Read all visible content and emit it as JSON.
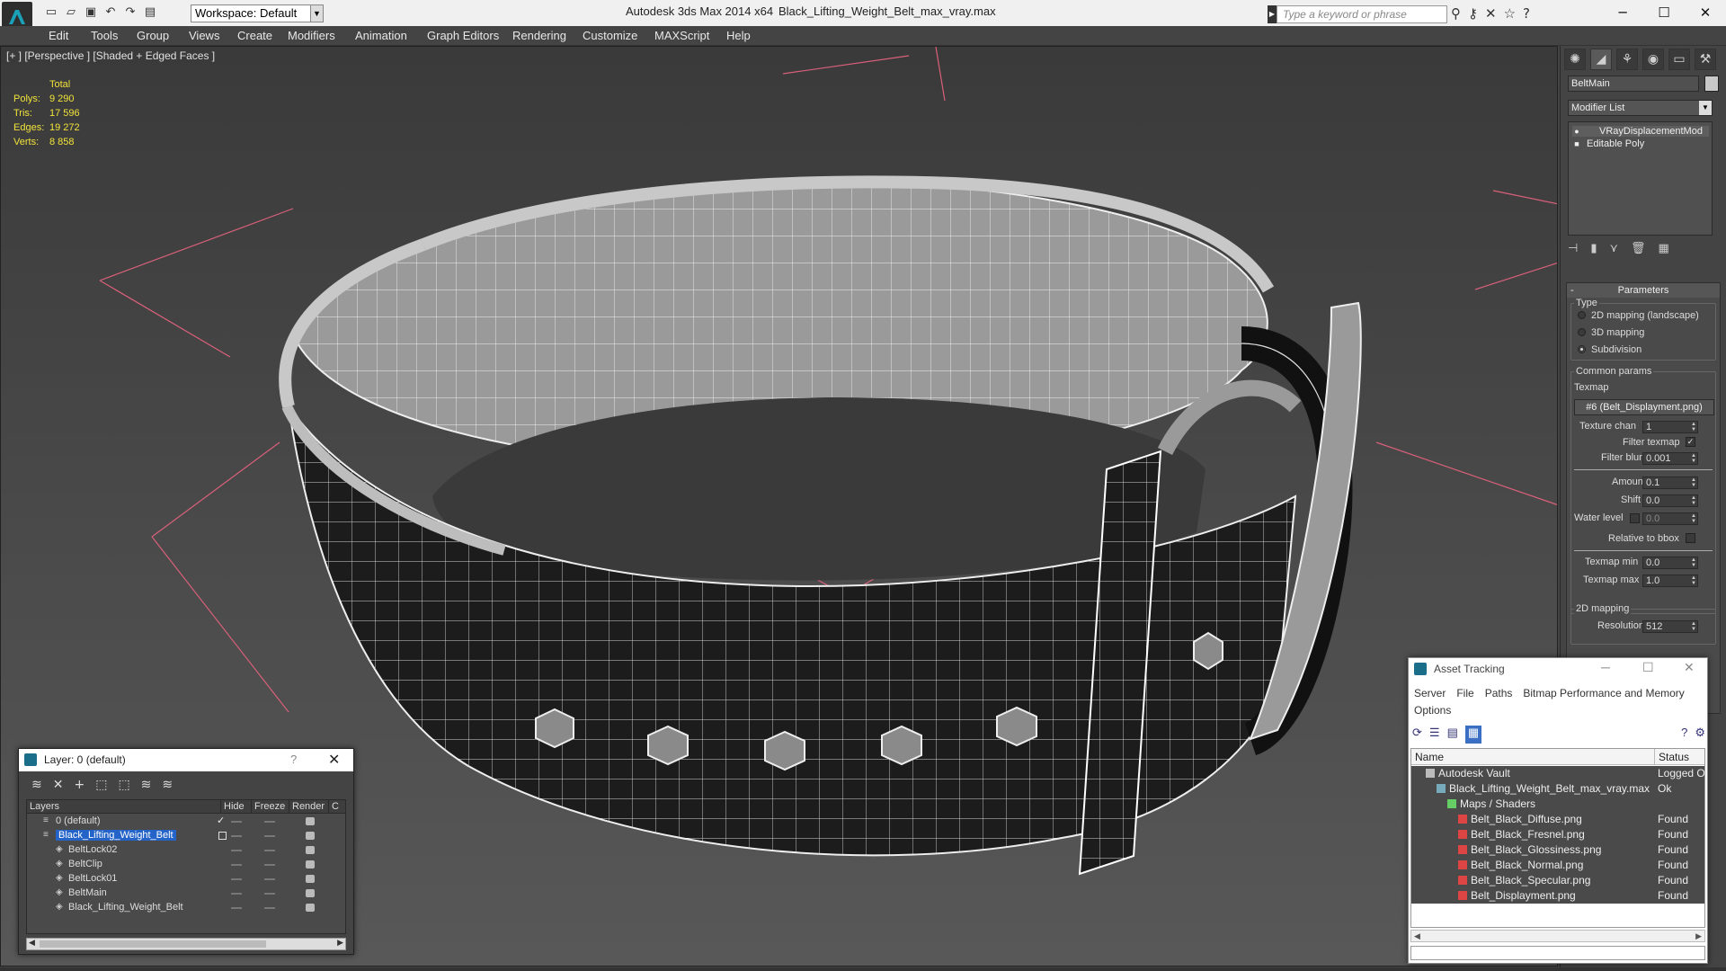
{
  "titlebar": {
    "workspace": "Workspace: Default",
    "app_title": "Autodesk 3ds Max  2014 x64",
    "file_title": "Black_Lifting_Weight_Belt_max_vray.max",
    "search_placeholder": "Type a keyword or phrase"
  },
  "menu": [
    "Edit",
    "Tools",
    "Group",
    "Views",
    "Create",
    "Modifiers",
    "Animation",
    "Graph Editors",
    "Rendering",
    "Customize",
    "MAXScript",
    "Help"
  ],
  "viewport": {
    "label": "[+ ] [Perspective ] [Shaded + Edged Faces ]",
    "stats": {
      "header": "Total",
      "rows": [
        {
          "k": "Polys:",
          "v": "9 290"
        },
        {
          "k": "Tris:",
          "v": "17 596"
        },
        {
          "k": "Edges:",
          "v": "19 272"
        },
        {
          "k": "Verts:",
          "v": "8 858"
        }
      ]
    }
  },
  "command_panel": {
    "object_name": "BeltMain",
    "modifier_list": "Modifier List",
    "stack": [
      "VRayDisplacementMod",
      "Editable Poly"
    ],
    "params": {
      "header": "Parameters",
      "type_label": "Type",
      "types": [
        "2D mapping (landscape)",
        "3D mapping",
        "Subdivision"
      ],
      "selected_type": "Subdivision",
      "common_label": "Common params",
      "texmap_label": "Texmap",
      "texmap_value": "#6 (Belt_Displayment.png)",
      "texture_chan_label": "Texture chan",
      "texture_chan": "1",
      "filter_texmap_label": "Filter texmap",
      "filter_blur_label": "Filter blur",
      "filter_blur": "0.001",
      "amount_label": "Amount",
      "amount": "0.1",
      "shift_label": "Shift",
      "shift": "0.0",
      "water_label": "Water level",
      "water": "0.0",
      "relative_label": "Relative to bbox",
      "texmap_min_label": "Texmap min",
      "texmap_min": "0.0",
      "texmap_max_label": "Texmap max",
      "texmap_max": "1.0",
      "mapping2d_label": "2D mapping",
      "resolution_label": "Resolution",
      "resolution": "512"
    }
  },
  "layer_window": {
    "title": "Layer: 0 (default)",
    "columns": [
      "Layers",
      "Hide",
      "Freeze",
      "Render",
      "C"
    ],
    "rows": [
      {
        "name": "0 (default)",
        "indent": 0,
        "selected": false
      },
      {
        "name": "Black_Lifting_Weight_Belt",
        "indent": 0,
        "selected": true
      },
      {
        "name": "BeltLock02",
        "indent": 1,
        "selected": false
      },
      {
        "name": "BeltClip",
        "indent": 1,
        "selected": false
      },
      {
        "name": "BeltLock01",
        "indent": 1,
        "selected": false
      },
      {
        "name": "BeltMain",
        "indent": 1,
        "selected": false
      },
      {
        "name": "Black_Lifting_Weight_Belt",
        "indent": 1,
        "selected": false
      }
    ]
  },
  "asset_window": {
    "title": "Asset Tracking",
    "menu": [
      "Server",
      "File",
      "Paths",
      "Bitmap Performance and Memory",
      "Options"
    ],
    "columns": [
      "Name",
      "Status"
    ],
    "rows": [
      {
        "name": "Autodesk Vault",
        "status": "Logged O",
        "indent": 1,
        "icon": "vault-icon"
      },
      {
        "name": "Black_Lifting_Weight_Belt_max_vray.max",
        "status": "Ok",
        "indent": 2,
        "icon": "max-file-icon"
      },
      {
        "name": "Maps / Shaders",
        "status": "",
        "indent": 3,
        "icon": "maps-icon"
      },
      {
        "name": "Belt_Black_Diffuse.png",
        "status": "Found",
        "indent": 4,
        "icon": "png-icon"
      },
      {
        "name": "Belt_Black_Fresnel.png",
        "status": "Found",
        "indent": 4,
        "icon": "png-icon"
      },
      {
        "name": "Belt_Black_Glossiness.png",
        "status": "Found",
        "indent": 4,
        "icon": "png-icon"
      },
      {
        "name": "Belt_Black_Normal.png",
        "status": "Found",
        "indent": 4,
        "icon": "png-icon"
      },
      {
        "name": "Belt_Black_Specular.png",
        "status": "Found",
        "indent": 4,
        "icon": "png-icon"
      },
      {
        "name": "Belt_Displayment.png",
        "status": "Found",
        "indent": 4,
        "icon": "png-icon"
      }
    ]
  },
  "colors": {
    "stats": "#f2e33a",
    "selection": "#2463c7",
    "grid": "#d9607a"
  }
}
